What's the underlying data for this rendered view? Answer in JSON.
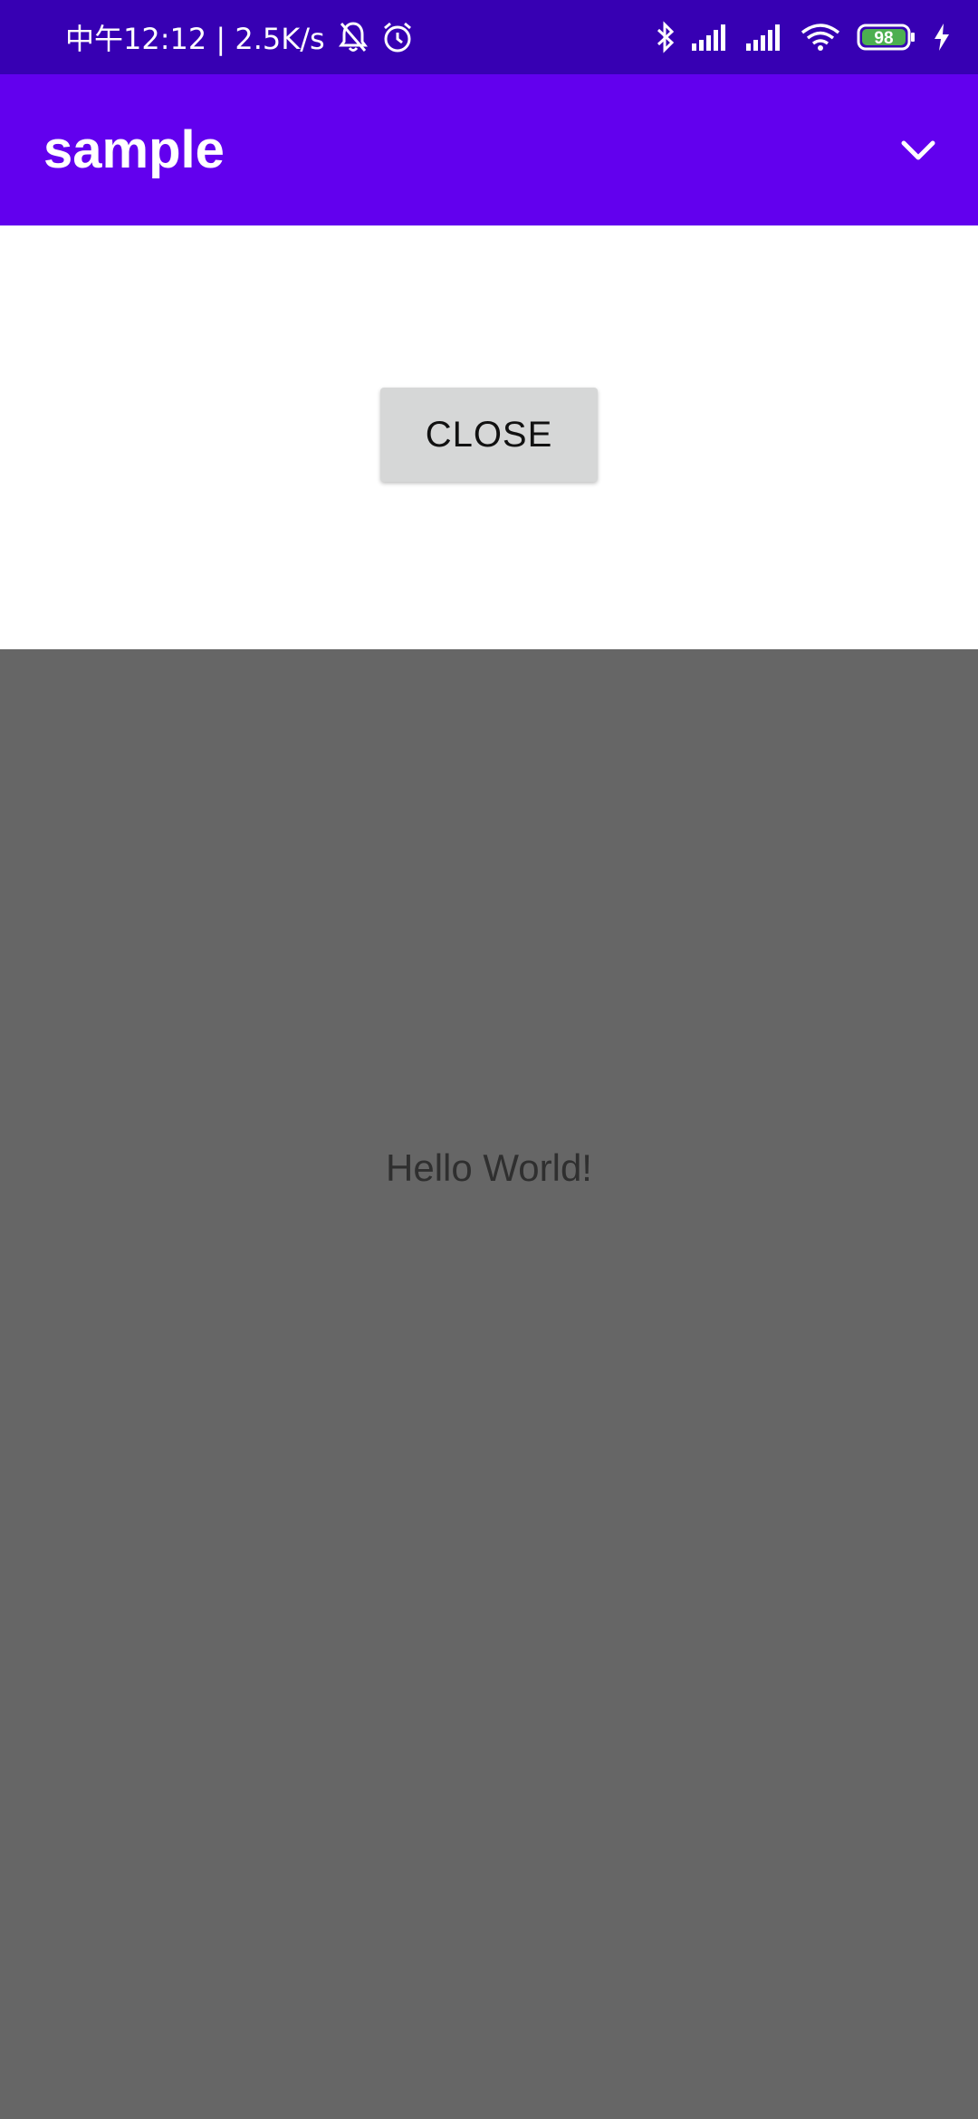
{
  "status_bar": {
    "time_speed": "中午12:12 | 2.5K/s",
    "battery_level": "98",
    "icons": [
      "bell-off-icon",
      "alarm-icon",
      "bluetooth-icon",
      "signal-icon",
      "signal-icon",
      "wifi-icon",
      "battery-icon",
      "charging-icon"
    ]
  },
  "app_bar": {
    "title": "sample",
    "expand_icon": "chevron-down-icon"
  },
  "sheet": {
    "close_label": "CLOSE"
  },
  "content": {
    "text": "Hello World!"
  },
  "colors": {
    "status_bar": "#3700b3",
    "app_bar": "#6200ee",
    "scrim": "#666666",
    "button": "#d6d7d7"
  }
}
